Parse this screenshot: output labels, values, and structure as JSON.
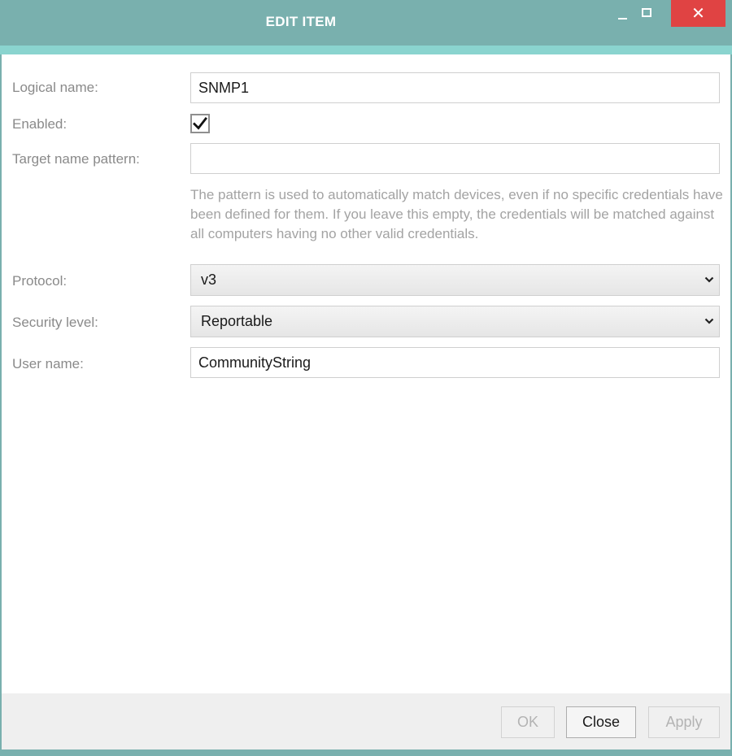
{
  "window": {
    "title": "EDIT ITEM",
    "close_glyph": "✕"
  },
  "form": {
    "logical_name": {
      "label": "Logical name:",
      "value": "SNMP1"
    },
    "enabled": {
      "label": "Enabled:",
      "checked": true
    },
    "target_pattern": {
      "label": "Target name pattern:",
      "value": "",
      "help": "The pattern is used to automatically match devices, even if no specific credentials have been defined for them. If you leave this empty, the credentials will be matched against all computers having no other valid credentials."
    },
    "protocol": {
      "label": "Protocol:",
      "selected": "v3"
    },
    "security_level": {
      "label": "Security level:",
      "selected": "Reportable"
    },
    "user_name": {
      "label": "User name:",
      "value": "CommunityString"
    }
  },
  "footer": {
    "ok_label": "OK",
    "close_label": "Close",
    "apply_label": "Apply"
  },
  "colors": {
    "titlebar": "#79b0ae",
    "accent": "#8ad4cf",
    "close_button": "#e04343"
  }
}
